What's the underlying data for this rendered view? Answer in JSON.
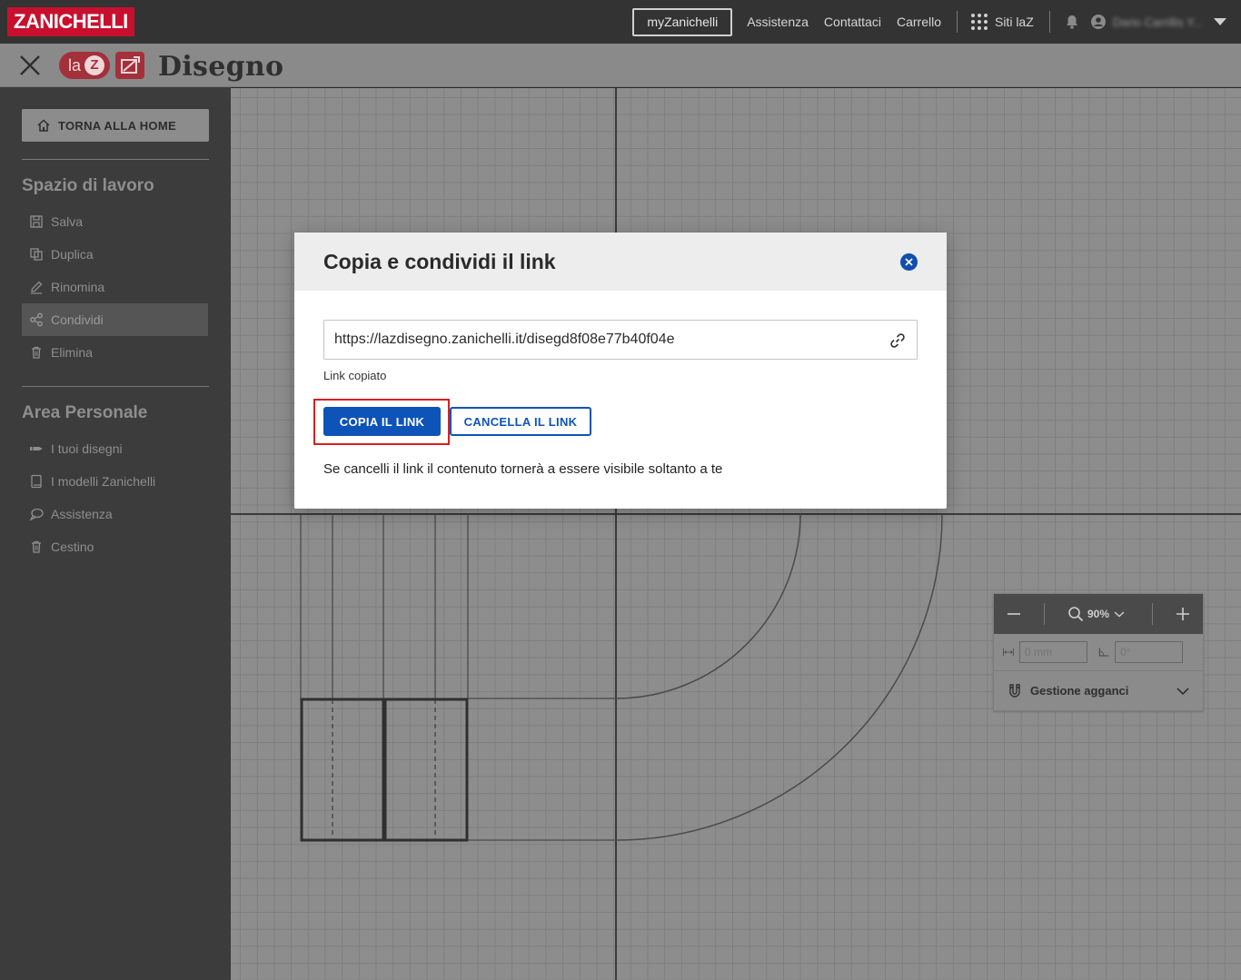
{
  "topbar": {
    "brand": "ZANICHELLI",
    "my_label": "myZanichelli",
    "links": [
      "Assistenza",
      "Contattaci",
      "Carrello"
    ],
    "sites_label": "Siti laZ",
    "user_name": "Dario Carrillis Y..."
  },
  "appbar": {
    "logo_prefix": "la",
    "logo_z": "Z",
    "title": "Disegno"
  },
  "sidebar": {
    "home_label": "TORNA ALLA HOME",
    "workspace_title": "Spazio di lavoro",
    "workspace_items": [
      "Salva",
      "Duplica",
      "Rinomina",
      "Condividi",
      "Elimina"
    ],
    "active_item": "Condividi",
    "personal_title": "Area Personale",
    "personal_items": [
      "I tuoi disegni",
      "I modelli Zanichelli",
      "Assistenza",
      "Cestino"
    ]
  },
  "zoom_panel": {
    "zoom_level": "90%",
    "length_placeholder": "0 mm",
    "angle_placeholder": "0°",
    "hooks_label": "Gestione agganci"
  },
  "modal": {
    "title": "Copia e condividi il link",
    "link_value": "https://lazdisegno.zanichelli.it/disegd8f08e77b40f04e",
    "status": "Link copiato",
    "copy_button": "COPIA IL LINK",
    "delete_button": "CANCELLA IL LINK",
    "note": "Se cancelli il link il contenuto tornerà a essere visibile soltanto a te"
  },
  "colors": {
    "accent": "#0d53b8",
    "brand": "#c8102e",
    "highlight": "#d92020"
  }
}
